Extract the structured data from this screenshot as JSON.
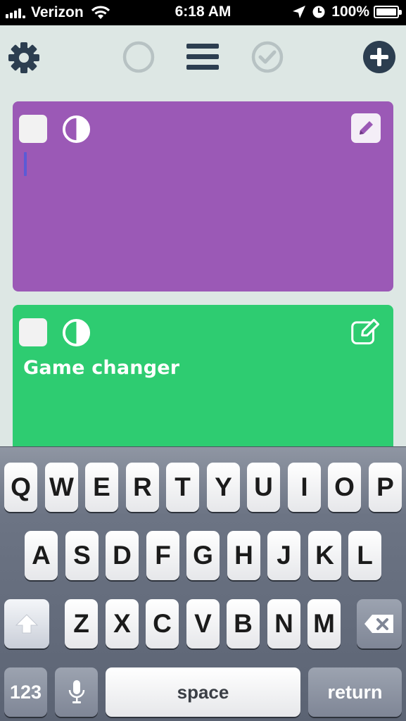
{
  "status_bar": {
    "carrier": "Verizon",
    "time": "6:18 AM",
    "battery": "100%",
    "battery_level": 1.0,
    "icons": [
      "signal-icon",
      "wifi-icon",
      "location-arrow-icon",
      "alarm-clock-icon",
      "battery-icon"
    ]
  },
  "toolbar": {
    "icons": [
      "gear-icon",
      "circle-outline-icon",
      "menu-icon",
      "check-circle-icon",
      "plus-circle-icon"
    ],
    "colors": {
      "dark": "#2c3e50",
      "muted": "#b7c2c3"
    }
  },
  "cards": [
    {
      "color": "#9b59b6",
      "title": "",
      "editing": true,
      "icons": [
        "checkbox-icon",
        "contrast-icon",
        "pencil-icon"
      ]
    },
    {
      "color": "#2ecc71",
      "title": "Game changer",
      "editing": false,
      "icons": [
        "checkbox-icon",
        "contrast-icon",
        "edit-square-icon"
      ]
    }
  ],
  "keyboard": {
    "row1": [
      "Q",
      "W",
      "E",
      "R",
      "T",
      "Y",
      "U",
      "I",
      "O",
      "P"
    ],
    "row2": [
      "A",
      "S",
      "D",
      "F",
      "G",
      "H",
      "J",
      "K",
      "L"
    ],
    "row3": [
      "Z",
      "X",
      "C",
      "V",
      "B",
      "N",
      "M"
    ],
    "numbers_key": "123",
    "space_key": "space",
    "return_key": "return",
    "icons": [
      "shift-icon",
      "backspace-icon",
      "microphone-icon"
    ]
  }
}
